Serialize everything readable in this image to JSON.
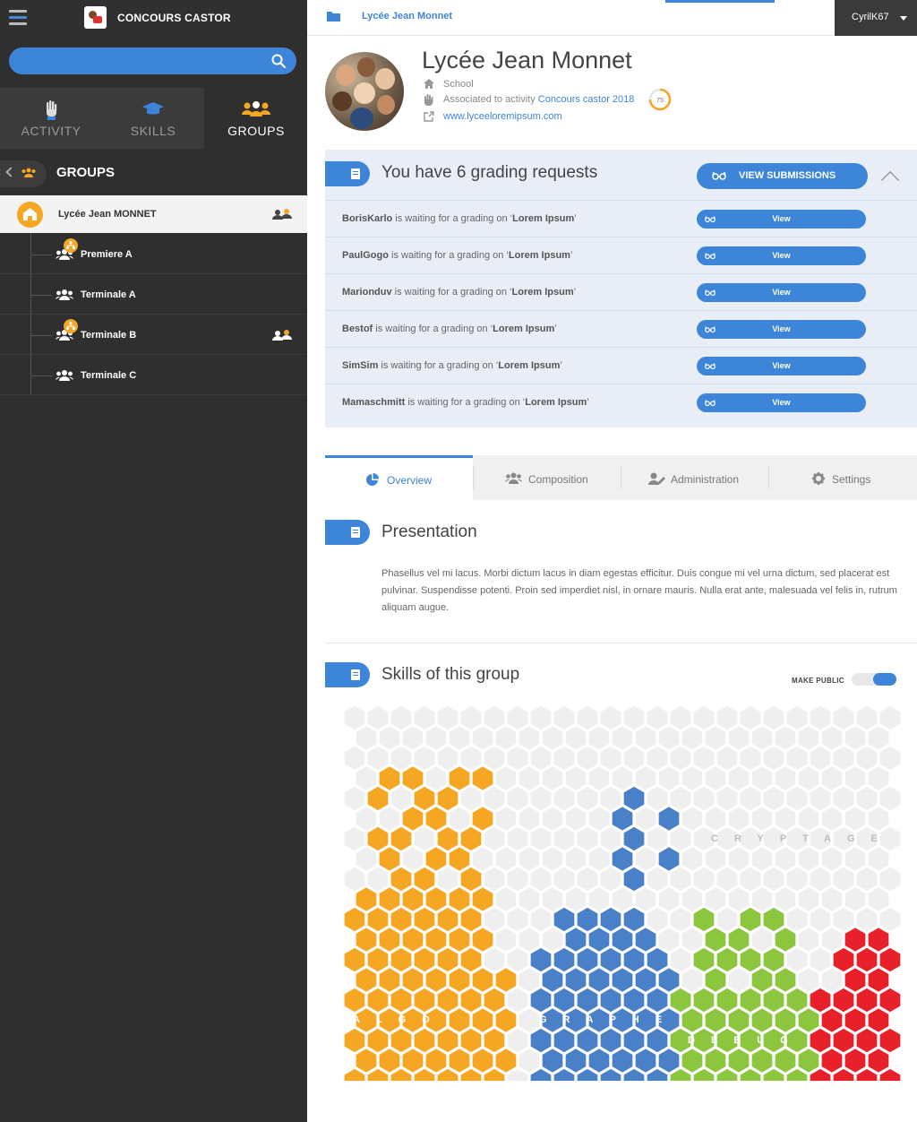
{
  "app": {
    "title": "CONCOURS CASTOR"
  },
  "search": {
    "placeholder": ""
  },
  "nav_tabs": [
    {
      "label": "ACTIVITY"
    },
    {
      "label": "SKILLS"
    },
    {
      "label": "GROUPS"
    }
  ],
  "groups_panel": {
    "title": "GROUPS"
  },
  "root_group": {
    "label": "Lycée Jean MONNET"
  },
  "groups": [
    {
      "label": "Premiere A"
    },
    {
      "label": "Terminale A"
    },
    {
      "label": "Terminale B"
    },
    {
      "label": "Terminale C"
    }
  ],
  "breadcrumb": {
    "label": "Lycée Jean Monnet"
  },
  "user": {
    "name": "CyrilK67"
  },
  "school": {
    "name": "Lycée Jean Monnet",
    "type": "School",
    "associated_prefix": "Associated to activity ",
    "activity_link": "Concours castor 2018",
    "score": "75",
    "website": "www.lyceeloremipsum.com"
  },
  "grading": {
    "title": "You have 6 grading requests",
    "view_submissions": "VIEW SUBMISSIONS",
    "requests": [
      {
        "user": "BorisKarlo",
        "middle": " is waiting for a grading on ‘",
        "item": "Lorem Ipsum",
        "end": "’",
        "button": "View"
      },
      {
        "user": "PaulGogo",
        "middle": " is waiting for a grading on ‘",
        "item": "Lorem Ipsum",
        "end": "’",
        "button": "View"
      },
      {
        "user": "Marionduv",
        "middle": " is waiting for a grading on ‘",
        "item": "Lorem Ipsum",
        "end": "’",
        "button": "View"
      },
      {
        "user": "Bestof",
        "middle": " is waiting for a grading on ‘",
        "item": "Lorem Ipsum",
        "end": "’",
        "button": "View"
      },
      {
        "user": "SimSim",
        "middle": " is waiting for a grading on ‘",
        "item": "Lorem Ipsum",
        "end": "’",
        "button": "View"
      },
      {
        "user": "Mamaschmitt",
        "middle": " is waiting for a grading on ‘",
        "item": "Lorem Ipsum",
        "end": "’",
        "button": "View"
      }
    ]
  },
  "content_tabs": [
    {
      "label": "Overview"
    },
    {
      "label": "Composition"
    },
    {
      "label": "Administration"
    },
    {
      "label": "Settings"
    }
  ],
  "presentation": {
    "title": "Presentation",
    "text": "Phasellus vel mi lacus. Morbi dictum lacus in diam egestas efficitur. Duis congue mi vel urna dictum, sed placerat est pulvinar. Suspendisse potenti. Proin sed imperdiet nisl, in ornare mauris. Nulla erat ante, malesuada vel felis in, rutrum aliquam augue."
  },
  "skills": {
    "title": "Skills of this group",
    "make_public": "MAKE PUBLIC",
    "make_public_on": true,
    "region_labels": [
      "ALGO",
      "GRAPHE",
      "DEBUG",
      "CRYPTAGE"
    ],
    "colors": {
      "algo": "#f5a623",
      "graphe": "#4a80c8",
      "debug": "#8cc63f",
      "cryptage": "#e8202a",
      "empty": "#efefef"
    }
  },
  "colors": {
    "accent": "#3d85d8",
    "sidebar": "#2f2f2f",
    "orange": "#f5a623"
  }
}
